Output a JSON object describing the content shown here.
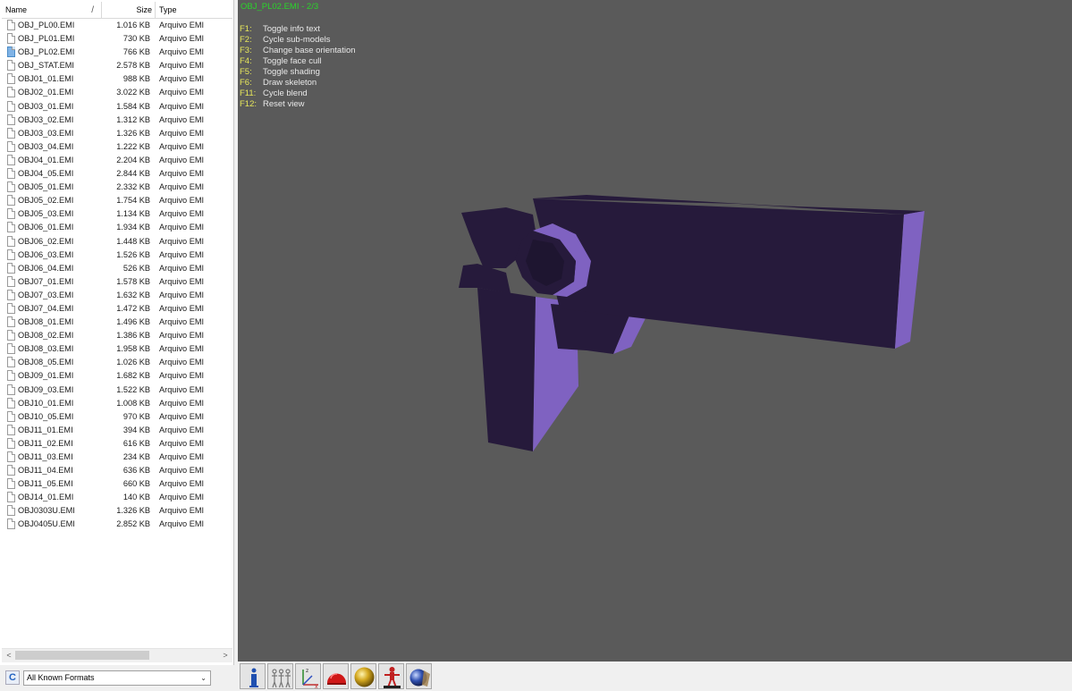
{
  "file_panel": {
    "columns": {
      "name": "Name",
      "size": "Size",
      "type": "Type"
    },
    "sort_glyph": "/",
    "files": [
      {
        "name": "OBJ_PL00.EMI",
        "size": "1.016 KB",
        "type": "Arquivo EMI"
      },
      {
        "name": "OBJ_PL01.EMI",
        "size": "730 KB",
        "type": "Arquivo EMI"
      },
      {
        "name": "OBJ_PL02.EMI",
        "size": "766 KB",
        "type": "Arquivo EMI",
        "selected": true
      },
      {
        "name": "OBJ_STAT.EMI",
        "size": "2.578 KB",
        "type": "Arquivo EMI"
      },
      {
        "name": "OBJ01_01.EMI",
        "size": "988 KB",
        "type": "Arquivo EMI"
      },
      {
        "name": "OBJ02_01.EMI",
        "size": "3.022 KB",
        "type": "Arquivo EMI"
      },
      {
        "name": "OBJ03_01.EMI",
        "size": "1.584 KB",
        "type": "Arquivo EMI"
      },
      {
        "name": "OBJ03_02.EMI",
        "size": "1.312 KB",
        "type": "Arquivo EMI"
      },
      {
        "name": "OBJ03_03.EMI",
        "size": "1.326 KB",
        "type": "Arquivo EMI"
      },
      {
        "name": "OBJ03_04.EMI",
        "size": "1.222 KB",
        "type": "Arquivo EMI"
      },
      {
        "name": "OBJ04_01.EMI",
        "size": "2.204 KB",
        "type": "Arquivo EMI"
      },
      {
        "name": "OBJ04_05.EMI",
        "size": "2.844 KB",
        "type": "Arquivo EMI"
      },
      {
        "name": "OBJ05_01.EMI",
        "size": "2.332 KB",
        "type": "Arquivo EMI"
      },
      {
        "name": "OBJ05_02.EMI",
        "size": "1.754 KB",
        "type": "Arquivo EMI"
      },
      {
        "name": "OBJ05_03.EMI",
        "size": "1.134 KB",
        "type": "Arquivo EMI"
      },
      {
        "name": "OBJ06_01.EMI",
        "size": "1.934 KB",
        "type": "Arquivo EMI"
      },
      {
        "name": "OBJ06_02.EMI",
        "size": "1.448 KB",
        "type": "Arquivo EMI"
      },
      {
        "name": "OBJ06_03.EMI",
        "size": "1.526 KB",
        "type": "Arquivo EMI"
      },
      {
        "name": "OBJ06_04.EMI",
        "size": "526 KB",
        "type": "Arquivo EMI"
      },
      {
        "name": "OBJ07_01.EMI",
        "size": "1.578 KB",
        "type": "Arquivo EMI"
      },
      {
        "name": "OBJ07_03.EMI",
        "size": "1.632 KB",
        "type": "Arquivo EMI"
      },
      {
        "name": "OBJ07_04.EMI",
        "size": "1.472 KB",
        "type": "Arquivo EMI"
      },
      {
        "name": "OBJ08_01.EMI",
        "size": "1.496 KB",
        "type": "Arquivo EMI"
      },
      {
        "name": "OBJ08_02.EMI",
        "size": "1.386 KB",
        "type": "Arquivo EMI"
      },
      {
        "name": "OBJ08_03.EMI",
        "size": "1.958 KB",
        "type": "Arquivo EMI"
      },
      {
        "name": "OBJ08_05.EMI",
        "size": "1.026 KB",
        "type": "Arquivo EMI"
      },
      {
        "name": "OBJ09_01.EMI",
        "size": "1.682 KB",
        "type": "Arquivo EMI"
      },
      {
        "name": "OBJ09_03.EMI",
        "size": "1.522 KB",
        "type": "Arquivo EMI"
      },
      {
        "name": "OBJ10_01.EMI",
        "size": "1.008 KB",
        "type": "Arquivo EMI"
      },
      {
        "name": "OBJ10_05.EMI",
        "size": "970 KB",
        "type": "Arquivo EMI"
      },
      {
        "name": "OBJ11_01.EMI",
        "size": "394 KB",
        "type": "Arquivo EMI"
      },
      {
        "name": "OBJ11_02.EMI",
        "size": "616 KB",
        "type": "Arquivo EMI"
      },
      {
        "name": "OBJ11_03.EMI",
        "size": "234 KB",
        "type": "Arquivo EMI"
      },
      {
        "name": "OBJ11_04.EMI",
        "size": "636 KB",
        "type": "Arquivo EMI"
      },
      {
        "name": "OBJ11_05.EMI",
        "size": "660 KB",
        "type": "Arquivo EMI"
      },
      {
        "name": "OBJ14_01.EMI",
        "size": "140 KB",
        "type": "Arquivo EMI"
      },
      {
        "name": "OBJ0303U.EMI",
        "size": "1.326 KB",
        "type": "Arquivo EMI"
      },
      {
        "name": "OBJ0405U.EMI",
        "size": "2.852 KB",
        "type": "Arquivo EMI"
      }
    ],
    "scroll": {
      "left_arrow": "<",
      "right_arrow": ">"
    },
    "format_filter": {
      "refresh_glyph": "C",
      "selected": "All Known Formats",
      "chevron": "⌄"
    }
  },
  "viewport": {
    "title": "OBJ_PL02.EMI - 2/3",
    "hotkeys": [
      {
        "key": "F1:",
        "label": "Toggle info text"
      },
      {
        "key": "F2:",
        "label": "Cycle sub-models"
      },
      {
        "key": "F3:",
        "label": "Change base orientation"
      },
      {
        "key": "F4:",
        "label": "Toggle face cull"
      },
      {
        "key": "F5:",
        "label": "Toggle shading"
      },
      {
        "key": "F6:",
        "label": "Draw skeleton"
      },
      {
        "key": "F11:",
        "label": "Cycle blend"
      },
      {
        "key": "F12:",
        "label": "Reset view"
      }
    ],
    "colors": {
      "background": "#5a5a5a",
      "model_dark": "#261a3b",
      "model_light": "#7f62c1",
      "title": "#2ad42a",
      "hotkey_key": "#e6e65a",
      "hotkey_label": "#e8e8e8"
    }
  },
  "toolbar": {
    "buttons": [
      {
        "name": "info-icon"
      },
      {
        "name": "models-icon"
      },
      {
        "name": "axis-icon"
      },
      {
        "name": "dome-icon"
      },
      {
        "name": "sphere-icon"
      },
      {
        "name": "skeleton-icon"
      },
      {
        "name": "blend-icon"
      }
    ]
  }
}
